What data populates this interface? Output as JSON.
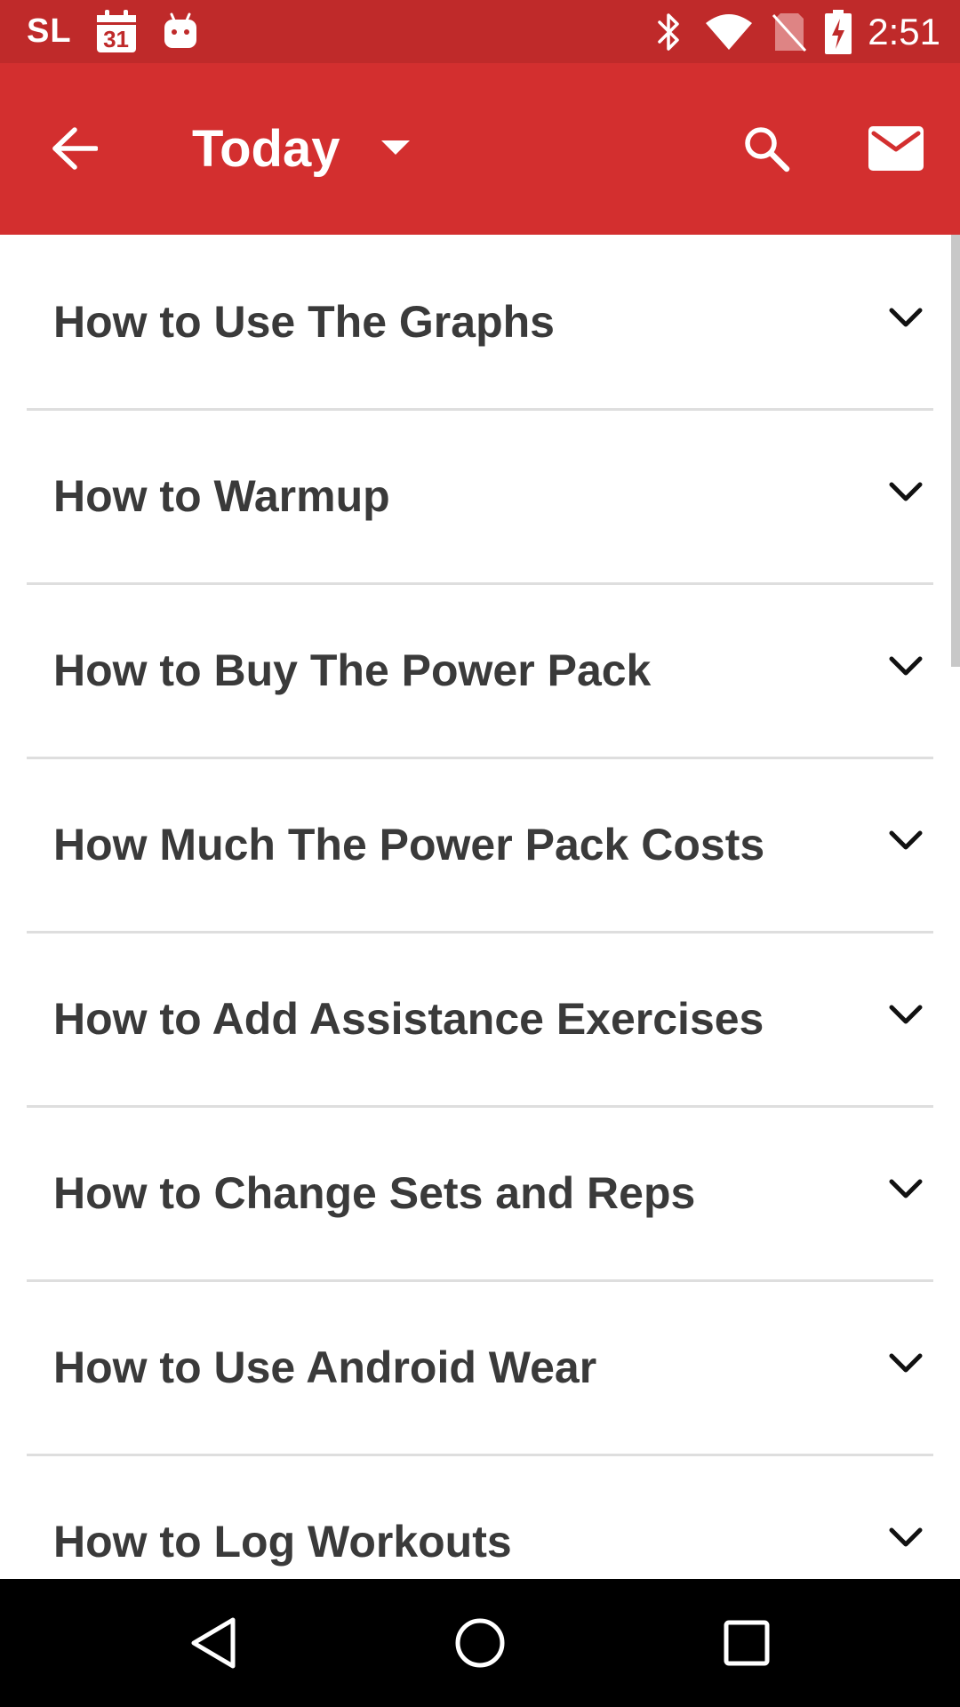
{
  "status_bar": {
    "carrier": "SL",
    "calendar_day": "31",
    "time": "2:51",
    "icons": [
      "calendar-icon",
      "android-icon",
      "bluetooth-icon",
      "wifi-icon",
      "no-sim-icon",
      "battery-charging-icon"
    ]
  },
  "toolbar": {
    "title": "Today",
    "icons": [
      "back-arrow-icon",
      "dropdown-caret-icon",
      "search-icon",
      "mail-icon"
    ]
  },
  "faq": {
    "items": [
      {
        "label": "How to Use The Graphs"
      },
      {
        "label": "How to Warmup"
      },
      {
        "label": "How to Buy The Power Pack"
      },
      {
        "label": "How Much The Power Pack Costs"
      },
      {
        "label": "How to Add Assistance Exercises"
      },
      {
        "label": "How to Change Sets and Reps"
      },
      {
        "label": "How to Use Android Wear"
      },
      {
        "label": "How to Log Workouts"
      }
    ]
  },
  "nav_bar": {
    "icons": [
      "nav-back-icon",
      "nav-home-icon",
      "nav-recent-icon"
    ]
  },
  "colors": {
    "status_bar": "#bf2a2a",
    "toolbar": "#d32f2f",
    "list_text": "#3a3a3a",
    "divider": "#dedede",
    "nav_bar": "#000000"
  }
}
